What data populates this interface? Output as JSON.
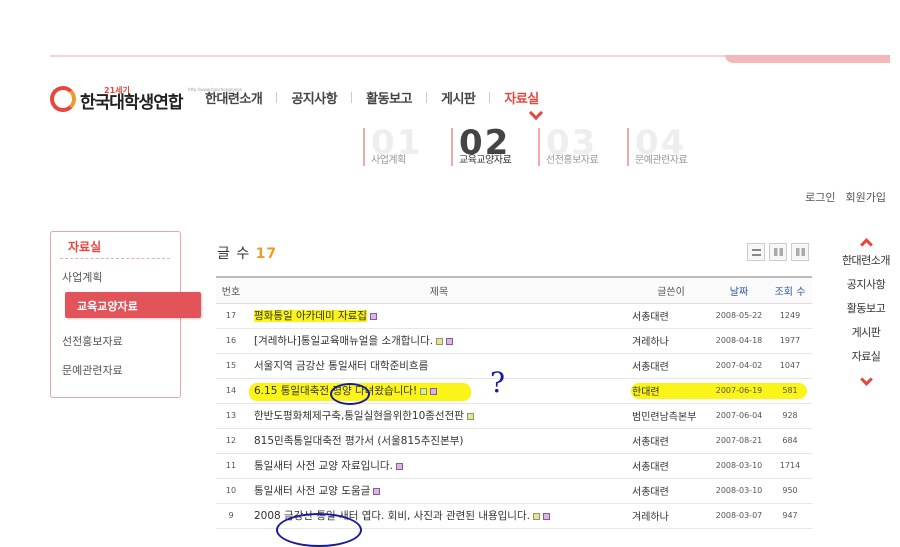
{
  "logo": {
    "sup": "21세기",
    "name": "한국대학생연합",
    "url": "http://www.hanchongryeon"
  },
  "gnb": [
    {
      "label": "한대련소개",
      "active": false
    },
    {
      "label": "공지사항",
      "active": false
    },
    {
      "label": "활동보고",
      "active": false
    },
    {
      "label": "게시판",
      "active": false
    },
    {
      "label": "자료실",
      "active": true
    }
  ],
  "subtabs": [
    {
      "num": "01",
      "label": "사업계획"
    },
    {
      "num": "02",
      "label": "교육교양자료"
    },
    {
      "num": "03",
      "label": "선전홍보자료"
    },
    {
      "num": "04",
      "label": "문예관련자료"
    }
  ],
  "auth": {
    "login": "로그인",
    "join": "회원가입"
  },
  "lnb": {
    "title": "자료실",
    "items": [
      "사업계획",
      "교육교양자료",
      "선전홍보자료",
      "문예관련자료"
    ]
  },
  "board": {
    "count_label": "글 수",
    "count": "17",
    "headers": {
      "num": "번호",
      "title": "제목",
      "writer": "글쓴이",
      "date": "날짜",
      "views": "조회 수"
    },
    "rows": [
      {
        "num": "17",
        "title": "평화통일 아카데미 자료집",
        "writer": "서총대련",
        "date": "2008-05-22",
        "views": "1249"
      },
      {
        "num": "16",
        "title": "[겨레하나]통일교육매뉴얼을 소개합니다.",
        "writer": "겨레하나",
        "date": "2008-04-18",
        "views": "1977"
      },
      {
        "num": "15",
        "title": "서울지역 금강산 통일새터 대학준비흐름",
        "writer": "서총대련",
        "date": "2007-04-02",
        "views": "1047"
      },
      {
        "num": "14",
        "title": "6.15 통일대축전 평양 다녀왔습니다!",
        "writer": "한대련",
        "date": "2007-06-19",
        "views": "581"
      },
      {
        "num": "13",
        "title": "한반도평화체제구축,통일실현을위한10종선전판",
        "writer": "범민련남측본부",
        "date": "2007-06-04",
        "views": "928"
      },
      {
        "num": "12",
        "title": "815민족통일대축전 평가서 (서울815추진본부)",
        "writer": "서총대련",
        "date": "2007-08-21",
        "views": "684"
      },
      {
        "num": "11",
        "title": "통일새터 사전 교양 자료입니다.",
        "writer": "서총대련",
        "date": "2008-03-10",
        "views": "1714"
      },
      {
        "num": "10",
        "title": "통일새터 사전 교양 도움글",
        "writer": "서총대련",
        "date": "2008-03-10",
        "views": "950"
      },
      {
        "num": "9",
        "title": "2008 금강산 통일 새터 엽다. 회비, 사진과 관련된 내용입니다.",
        "writer": "겨레하나",
        "date": "2008-03-07",
        "views": "947"
      }
    ]
  },
  "annotation": {
    "question": "?"
  },
  "quick": [
    "한대련소개",
    "공지사항",
    "활동보고",
    "게시판",
    "자료실"
  ]
}
